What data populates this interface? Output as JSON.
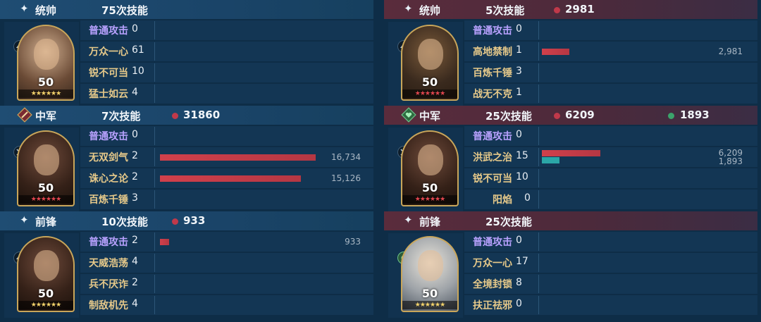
{
  "colors": {
    "bg": "#0e2d47",
    "left_header": "#1f4d73",
    "right_header": "#5a2c3c",
    "bar_red": "#c0394a",
    "bar_teal": "#2ba6a7",
    "skill_basic": "#b9a2ff",
    "skill_gold": "#e6c98a"
  },
  "left": {
    "blocks": [
      {
        "role": "统帅",
        "role_icon": "sparkle-icon",
        "skills": "75次技能",
        "damage": "",
        "heal": "",
        "level": "50",
        "stars": "★★★★★★",
        "rows": [
          {
            "name": "普通攻击",
            "count": "0",
            "value": "",
            "ratio": 0
          },
          {
            "name": "万众一心",
            "count": "61",
            "value": "",
            "ratio": 0
          },
          {
            "name": "锐不可当",
            "count": "10",
            "value": "",
            "ratio": 0
          },
          {
            "name": "猛士如云",
            "count": "4",
            "value": "",
            "ratio": 0
          }
        ]
      },
      {
        "role": "中军",
        "role_icon": "sword-badge-icon",
        "skills": "7次技能",
        "damage": "31860",
        "heal": "",
        "level": "50",
        "stars": "★★★★★★",
        "rows": [
          {
            "name": "普通攻击",
            "count": "0",
            "value": "",
            "ratio": 0
          },
          {
            "name": "无双剑气",
            "count": "2",
            "value": "16,734",
            "ratio": 0.96
          },
          {
            "name": "诛心之论",
            "count": "2",
            "value": "15,126",
            "ratio": 0.87
          },
          {
            "name": "百炼千锤",
            "count": "3",
            "value": "",
            "ratio": 0
          }
        ]
      },
      {
        "role": "前锋",
        "role_icon": "sparkle-icon",
        "skills": "10次技能",
        "damage": "933",
        "heal": "",
        "level": "50",
        "stars": "★★★★★★",
        "rows": [
          {
            "name": "普通攻击",
            "count": "2",
            "value": "933",
            "ratio": 0.055
          },
          {
            "name": "天威浩荡",
            "count": "4",
            "value": "",
            "ratio": 0
          },
          {
            "name": "兵不厌诈",
            "count": "2",
            "value": "",
            "ratio": 0
          },
          {
            "name": "制敌机先",
            "count": "4",
            "value": "",
            "ratio": 0
          }
        ]
      }
    ]
  },
  "right": {
    "blocks": [
      {
        "role": "统帅",
        "role_icon": "sparkle-icon",
        "skills": "5次技能",
        "damage": "2981",
        "heal": "",
        "level": "50",
        "stars": "★★★★★★",
        "rows": [
          {
            "name": "普通攻击",
            "count": "0",
            "value": "",
            "ratio": 0
          },
          {
            "name": "高地禁制",
            "count": "1",
            "value": "2,981",
            "ratio": 0.17
          },
          {
            "name": "百炼千锤",
            "count": "3",
            "value": "",
            "ratio": 0
          },
          {
            "name": "战无不克",
            "count": "1",
            "value": "",
            "ratio": 0
          }
        ]
      },
      {
        "role": "中军",
        "role_icon": "heart-badge-icon",
        "skills": "25次技能",
        "damage": "6209",
        "heal": "1893",
        "level": "50",
        "stars": "★★★★★★",
        "rows": [
          {
            "name": "普通攻击",
            "count": "0",
            "value": "",
            "ratio": 0
          },
          {
            "name": "洪武之治",
            "count": "15",
            "value": "6,209",
            "value2": "1,893",
            "ratio": 0.36,
            "ratio2": 0.11
          },
          {
            "name": "锐不可当",
            "count": "10",
            "value": "",
            "ratio": 0
          },
          {
            "name": "阳焰",
            "count": "0",
            "value": "",
            "ratio": 0
          }
        ]
      },
      {
        "role": "前锋",
        "role_icon": "sparkle-icon",
        "skills": "25次技能",
        "damage": "",
        "heal": "",
        "level": "50",
        "stars": "★★★★★★",
        "rows": [
          {
            "name": "普通攻击",
            "count": "0",
            "value": "",
            "ratio": 0
          },
          {
            "name": "万众一心",
            "count": "17",
            "value": "",
            "ratio": 0
          },
          {
            "name": "全境封锁",
            "count": "8",
            "value": "",
            "ratio": 0
          },
          {
            "name": "扶正祛邪",
            "count": "0",
            "value": "",
            "ratio": 0
          }
        ]
      }
    ]
  }
}
